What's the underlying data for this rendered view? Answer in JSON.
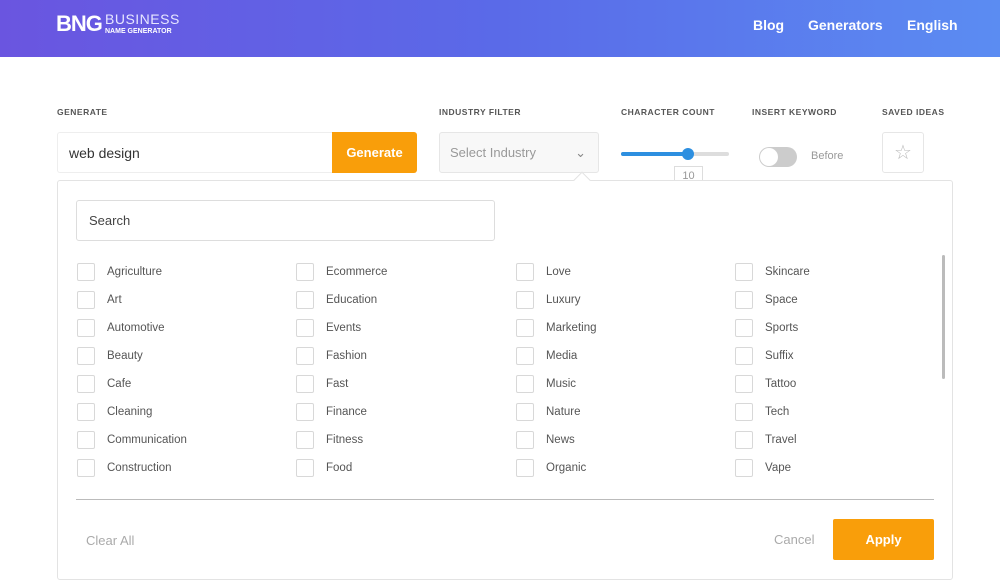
{
  "header": {
    "logo_mark": "BNG",
    "logo_title": "BUSINESS",
    "logo_subtitle": "NAME GENERATOR",
    "nav": [
      "Blog",
      "Generators",
      "English"
    ]
  },
  "controls": {
    "generate_label": "GENERATE",
    "generate_value": "web design",
    "generate_button": "Generate",
    "industry_label": "INDUSTRY FILTER",
    "industry_placeholder": "Select Industry",
    "charcount_label": "CHARACTER COUNT",
    "charcount_value": "10",
    "charcount_fraction": 0.62,
    "keyword_label": "INSERT KEYWORD",
    "keyword_position": "Before",
    "keyword_enabled": false,
    "saved_label": "SAVED IDEAS"
  },
  "industry_panel": {
    "search_placeholder": "Search",
    "columns": [
      [
        "Agriculture",
        "Art",
        "Automotive",
        "Beauty",
        "Cafe",
        "Cleaning",
        "Communication",
        "Construction"
      ],
      [
        "Ecommerce",
        "Education",
        "Events",
        "Fashion",
        "Fast",
        "Finance",
        "Fitness",
        "Food"
      ],
      [
        "Love",
        "Luxury",
        "Marketing",
        "Media",
        "Music",
        "Nature",
        "News",
        "Organic"
      ],
      [
        "Skincare",
        "Space",
        "Sports",
        "Suffix",
        "Tattoo",
        "Tech",
        "Travel",
        "Vape"
      ]
    ],
    "clear_all": "Clear All",
    "cancel": "Cancel",
    "apply": "Apply"
  }
}
